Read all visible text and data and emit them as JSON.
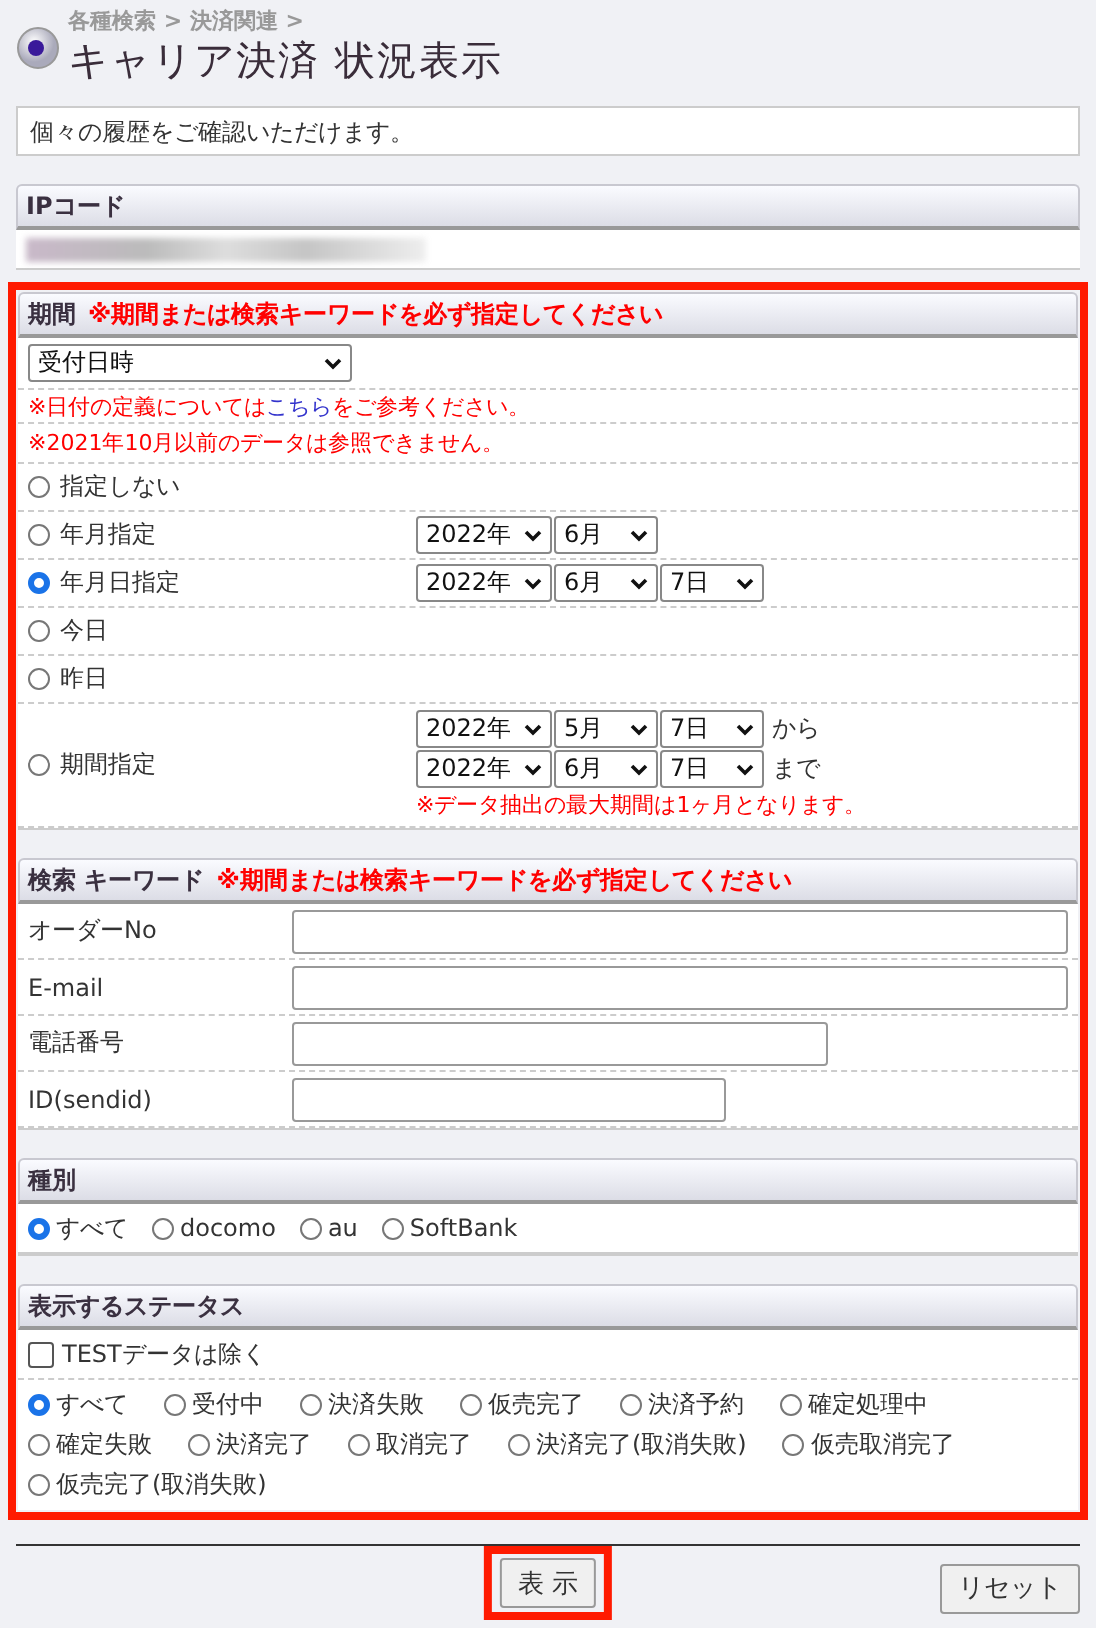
{
  "breadcrumb": "各種検索 > 決済関連 >",
  "title": "キャリア決済 状況表示",
  "description": "個々の履歴をご確認いただけます。",
  "ip_code": {
    "label": "IPコード",
    "value_redacted": true
  },
  "form": {
    "highlighted": true
  },
  "period": {
    "label": "期間",
    "required_note": "※期間または検索キーワードを必ず指定してください",
    "date_type": "受付日時",
    "notes": [
      {
        "before": "※日付の定義については",
        "link": "こちら",
        "after": "をご参考ください。"
      },
      {
        "before": "※2021年10月以前のデータは参照できません。"
      }
    ],
    "options": [
      {
        "kind": "none",
        "label": "指定しない",
        "selected": false
      },
      {
        "kind": "month",
        "label": "年月指定",
        "selected": false,
        "selects": [
          "2022年",
          "6月"
        ]
      },
      {
        "kind": "date",
        "label": "年月日指定",
        "selected": true,
        "selects": [
          "2022年",
          "6月",
          "7日"
        ]
      },
      {
        "kind": "none",
        "label": "今日",
        "selected": false
      },
      {
        "kind": "none",
        "label": "昨日",
        "selected": false
      },
      {
        "kind": "range",
        "label": "期間指定",
        "selected": false,
        "from": [
          "2022年",
          "5月",
          "7日"
        ],
        "from_suffix": "から",
        "to": [
          "2022年",
          "6月",
          "7日"
        ],
        "to_suffix": "まで",
        "warning": "※データ抽出の最大期間は1ヶ月となります。"
      }
    ]
  },
  "keyword": {
    "label": "検索 キーワード",
    "required_note": "※期間または検索キーワードを必ず指定してください",
    "fields": [
      {
        "label": "オーダーNo",
        "kind": "wide"
      },
      {
        "label": "E-mail",
        "kind": "wide"
      },
      {
        "label": "電話番号",
        "kind": "medium"
      },
      {
        "label": "ID(sendid)",
        "kind": "short"
      }
    ]
  },
  "carrier": {
    "label": "種別",
    "options": [
      {
        "label": "すべて",
        "selected": true
      },
      {
        "label": "docomo",
        "selected": false
      },
      {
        "label": "au",
        "selected": false
      },
      {
        "label": "SoftBank",
        "selected": false
      }
    ]
  },
  "status": {
    "label": "表示するステータス",
    "exclude_test": {
      "label": "TESTデータは除く",
      "checked": false
    },
    "options": [
      {
        "label": "すべて",
        "selected": true
      },
      {
        "label": "受付中",
        "selected": false
      },
      {
        "label": "決済失敗",
        "selected": false
      },
      {
        "label": "仮売完了",
        "selected": false
      },
      {
        "label": "決済予約",
        "selected": false
      },
      {
        "label": "確定処理中",
        "selected": false
      },
      {
        "label": "確定失敗",
        "selected": false
      },
      {
        "label": "決済完了",
        "selected": false
      },
      {
        "label": "取消完了",
        "selected": false
      },
      {
        "label": "決済完了(取消失敗)",
        "selected": false
      },
      {
        "label": "仮売取消完了",
        "selected": false
      },
      {
        "label": "仮売完了(取消失敗)",
        "selected": false
      }
    ]
  },
  "buttons": {
    "submit": {
      "label": "表 示",
      "highlighted": true
    },
    "reset": {
      "label": "リセット"
    }
  }
}
